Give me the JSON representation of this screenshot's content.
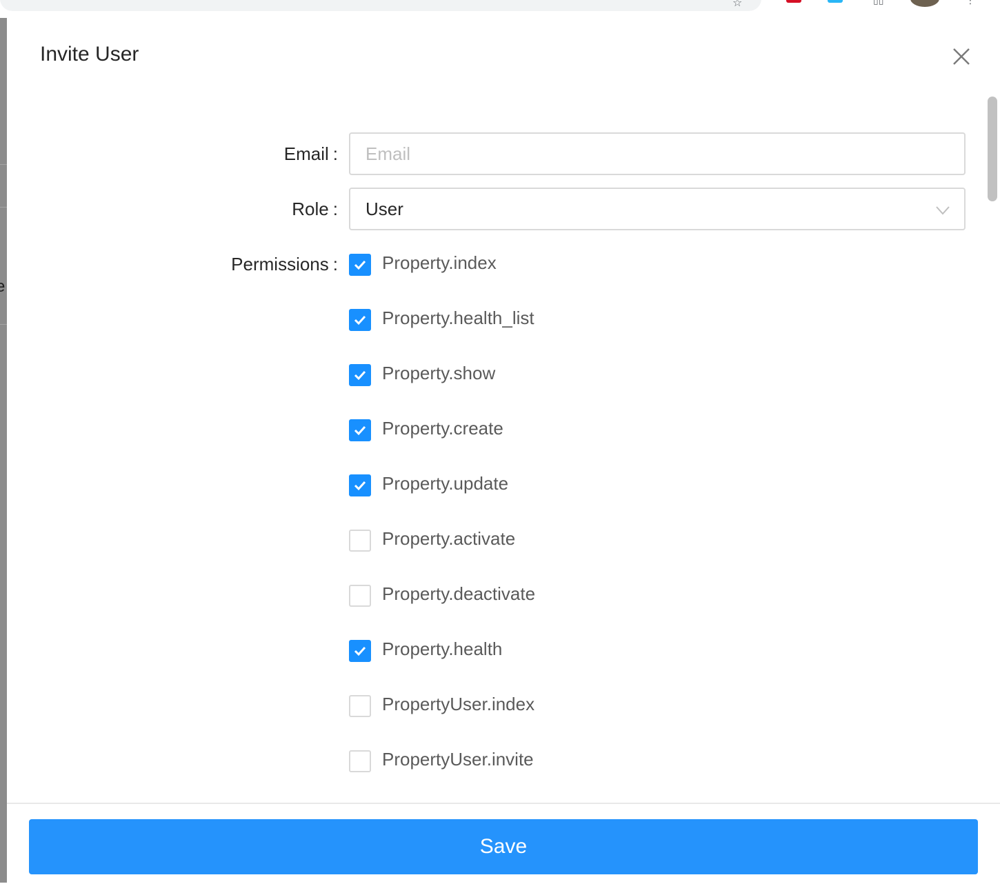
{
  "colors": {
    "primary": "#1890ff",
    "save_button": "#2593fc",
    "border": "#d9d9d9"
  },
  "drawer": {
    "title": "Invite User"
  },
  "form": {
    "email_label": "Email",
    "email_placeholder": "Email",
    "email_value": "",
    "role_label": "Role",
    "role_value": "User",
    "permissions_label": "Permissions",
    "label_separator": ":"
  },
  "permissions": [
    {
      "label": "Property.index",
      "checked": true
    },
    {
      "label": "Property.health_list",
      "checked": true
    },
    {
      "label": "Property.show",
      "checked": true
    },
    {
      "label": "Property.create",
      "checked": true
    },
    {
      "label": "Property.update",
      "checked": true
    },
    {
      "label": "Property.activate",
      "checked": false
    },
    {
      "label": "Property.deactivate",
      "checked": false
    },
    {
      "label": "Property.health",
      "checked": true
    },
    {
      "label": "PropertyUser.index",
      "checked": false
    },
    {
      "label": "PropertyUser.invite",
      "checked": false
    }
  ],
  "footer": {
    "save_label": "Save"
  }
}
